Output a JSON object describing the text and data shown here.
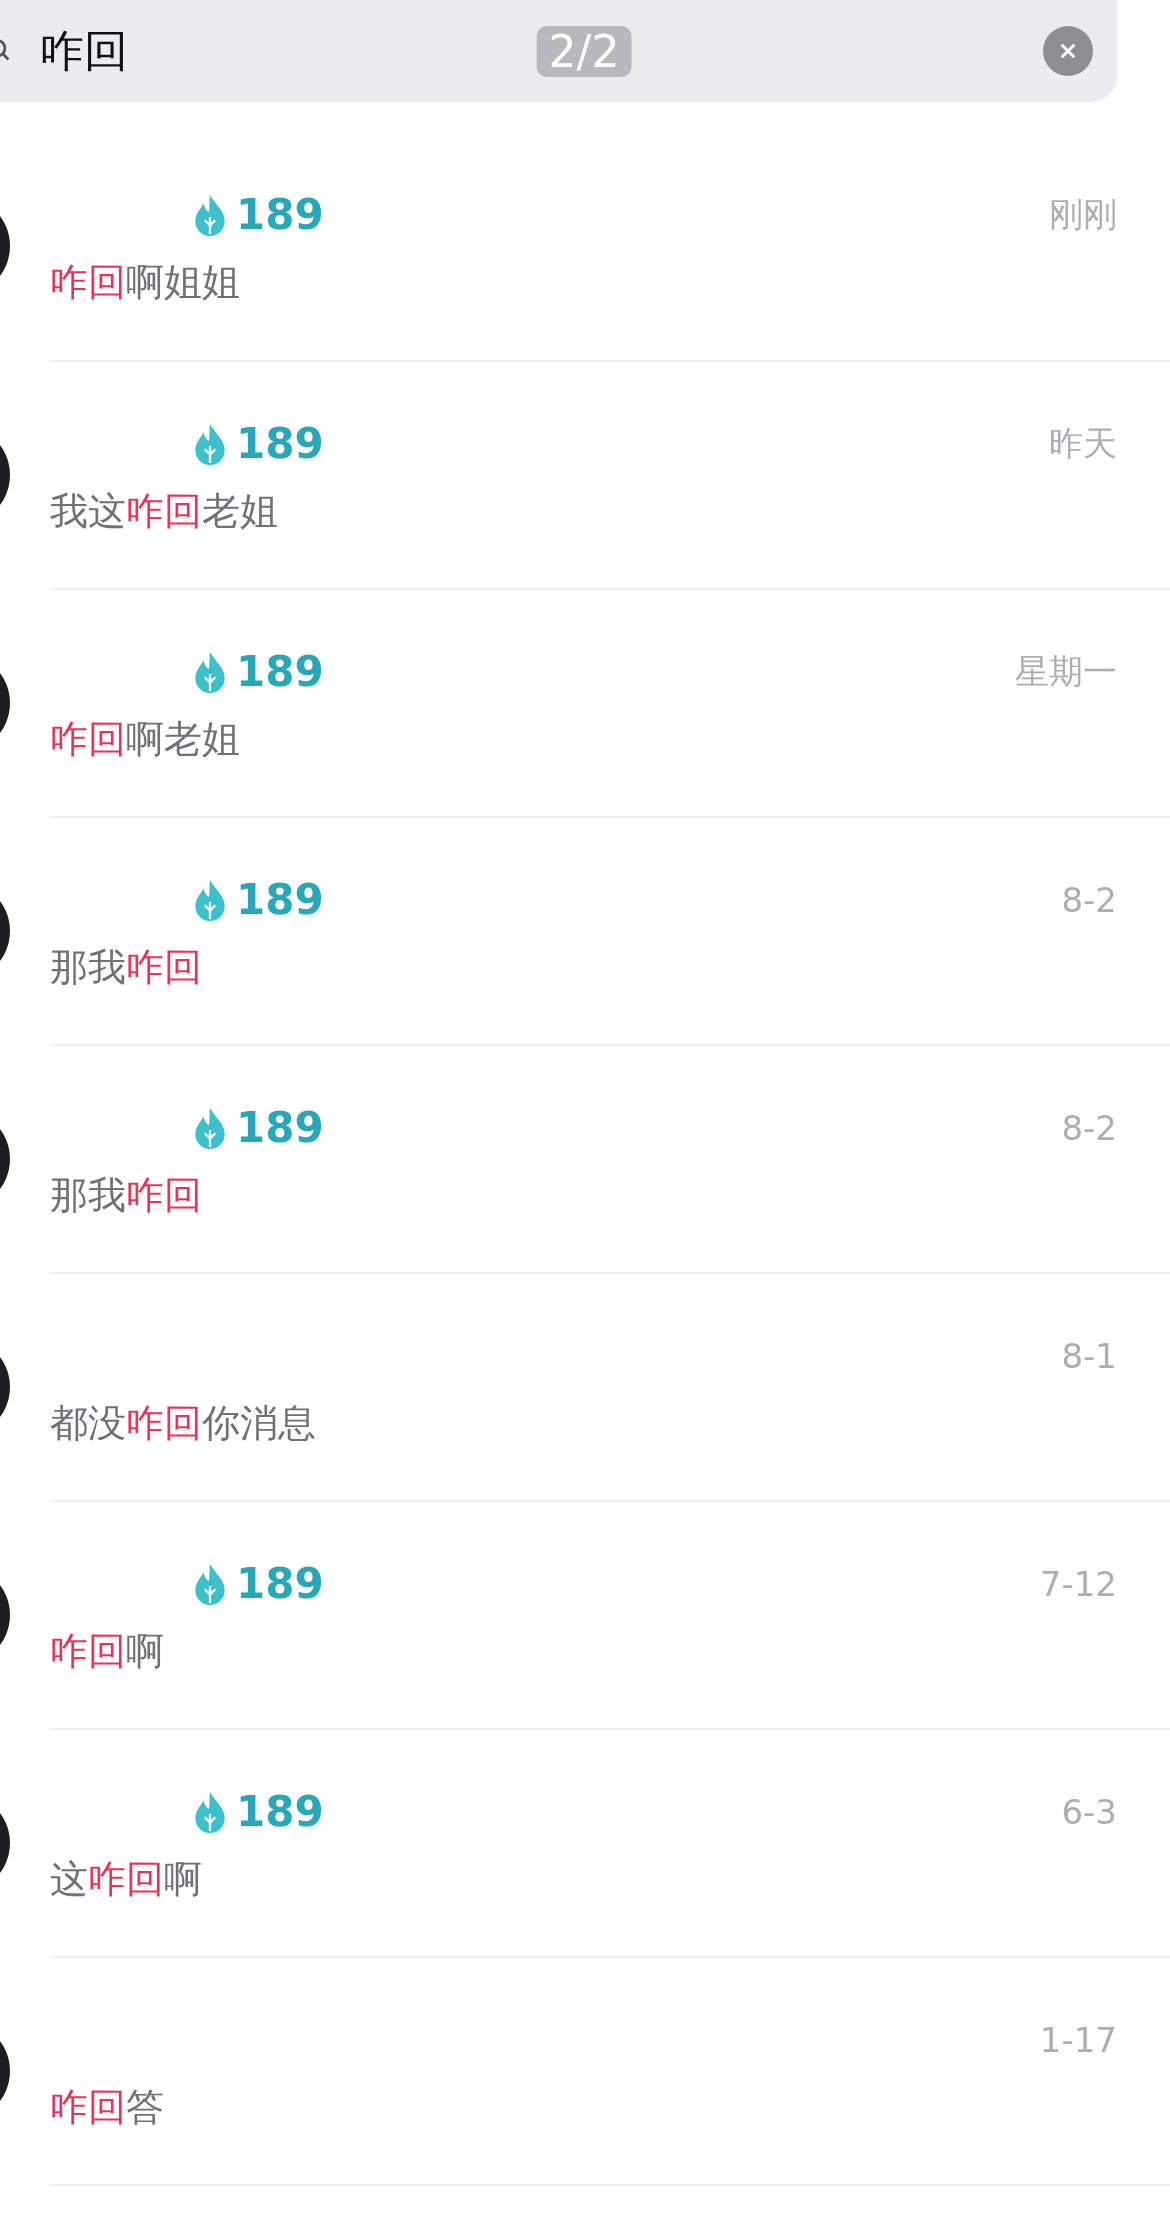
{
  "search": {
    "query": "咋回",
    "counter": "2/2"
  },
  "results": [
    {
      "streak": "189",
      "time": "刚刚",
      "message": [
        {
          "text": "咋回",
          "highlight": true
        },
        {
          "text": "啊姐姐",
          "highlight": false
        }
      ]
    },
    {
      "streak": "189",
      "time": "昨天",
      "message": [
        {
          "text": "我这",
          "highlight": false
        },
        {
          "text": "咋回",
          "highlight": true
        },
        {
          "text": "老姐",
          "highlight": false
        }
      ]
    },
    {
      "streak": "189",
      "time": "星期一",
      "message": [
        {
          "text": "咋回",
          "highlight": true
        },
        {
          "text": "啊老姐",
          "highlight": false
        }
      ]
    },
    {
      "streak": "189",
      "time": "8-2",
      "message": [
        {
          "text": "那我",
          "highlight": false
        },
        {
          "text": "咋回",
          "highlight": true
        }
      ]
    },
    {
      "streak": "189",
      "time": "8-2",
      "message": [
        {
          "text": "那我",
          "highlight": false
        },
        {
          "text": "咋回",
          "highlight": true
        }
      ]
    },
    {
      "time": "8-1",
      "message": [
        {
          "text": "都没",
          "highlight": false
        },
        {
          "text": "咋回",
          "highlight": true
        },
        {
          "text": "你消息",
          "highlight": false
        }
      ]
    },
    {
      "streak": "189",
      "time": "7-12",
      "message": [
        {
          "text": "咋回",
          "highlight": true
        },
        {
          "text": "啊",
          "highlight": false
        }
      ]
    },
    {
      "streak": "189",
      "time": "6-3",
      "message": [
        {
          "text": "这",
          "highlight": false
        },
        {
          "text": "咋回",
          "highlight": true
        },
        {
          "text": "啊",
          "highlight": false
        }
      ]
    },
    {
      "time": "1-17",
      "message": [
        {
          "text": "咋回",
          "highlight": true
        },
        {
          "text": "答",
          "highlight": false
        }
      ]
    }
  ]
}
